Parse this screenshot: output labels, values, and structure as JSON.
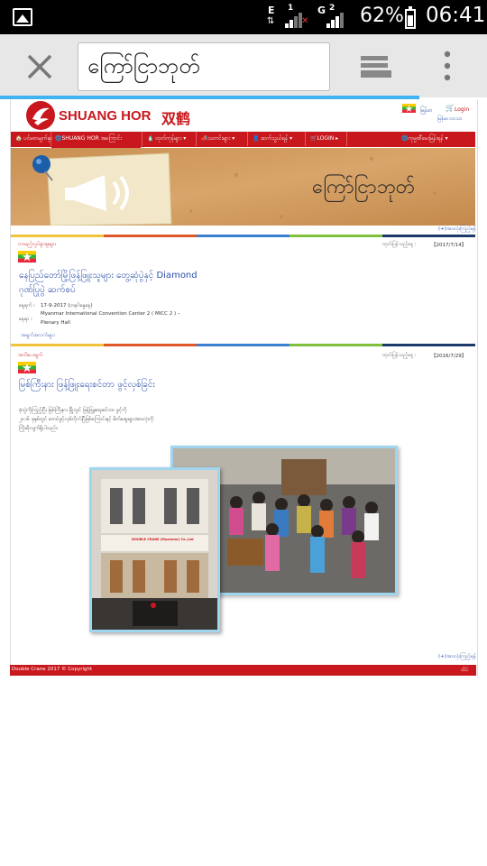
{
  "status_bar": {
    "net1": "E",
    "sim1": "1",
    "net2": "G",
    "sim2": "2",
    "battery": "62%",
    "time": "06:41"
  },
  "browser": {
    "url_text": "ကြော်ငြာဘုတ်"
  },
  "site": {
    "brand": {
      "latin": "SHUANG HOR",
      "chinese": "双鹤"
    },
    "lang": {
      "myanmar": "မြန်မာ",
      "login": "Login",
      "register": "မြန်မာဘာသာ"
    },
    "nav": [
      "ပင်မစာမျက်နှာ",
      "SHUANG HOR အကြောင်း",
      "ထုတ်ကုန်များ",
      "သတင်းများ",
      "ဆက်သွယ်ရန်",
      "LOGIN",
      "ကုမ္ပဏီမေးမြန်းရန်"
    ],
    "banner_title": "ကြော်ငြာဘုတ်",
    "more_link": "(+)အားလုံးကြည့်ရန်",
    "posts": [
      {
        "category": "လာမည့်လှုပ်ရှားမှုများ",
        "date_label": "ထုတ်ပြန်သည့်နေ့ :",
        "date": "【2017/7/14】",
        "title_line1": "နေပြည်တော်မြို့ဖြန့်ဖြူးသူများ တွေ့ဆုံပွဲနှင့် Diamond",
        "title_line2": "ဂုဏ်ပြုပွဲ ဆက်စပ်",
        "detail1_label": "နေ့ရက် :",
        "detail1_value": "17-9-2017 (တနင်္ဂနွေနေ့)",
        "detail2_label": "နေရာ :",
        "detail2_value_line1": "Myanmar International Convention Center 2 ( MICC 2 ) –",
        "detail2_value_line2": "Plenary Hall",
        "read_more": "အချက်အလက်များ"
      },
      {
        "category": "အသိပေးချက်",
        "date_label": "ထုတ်ပြန်သည့်နေ့ :",
        "date": "【2016/7/29】",
        "title": "မြစ်ကြီးနား ဖြန့်ဖြူးရေးစင်တာ ဖွင့်လှစ်ခြင်း",
        "body_line1": "စုံတွဲကိုကြည့်ပြီး မြစ်ကြီးနား မြို့တွင် ဖြန့်ဖြူးရေးစင်တာ ဖွင့်ကို",
        "body_line2": "၂၀၁၆ ခုနှစ်တွင် စတင်ဖွင့်လှစ်လိုက်ပြီဖြစ်ကြောင်းနှင့် မိတ်ဆွေများအားလုံးကို",
        "body_line3": "ကြိုဆိုလျက်ရှိပါသည်။",
        "photo_sign": "DOUBLE CRANE (Myanmar) Co.,Ltd"
      }
    ],
    "footer": {
      "copyright": "Double Crane 2017 © Copyright",
      "right": "ထိပ်"
    }
  },
  "colors": {
    "brand_red": "#c8181d",
    "link_blue": "#2a4fa8",
    "progress_blue": "#3fb4f0"
  }
}
